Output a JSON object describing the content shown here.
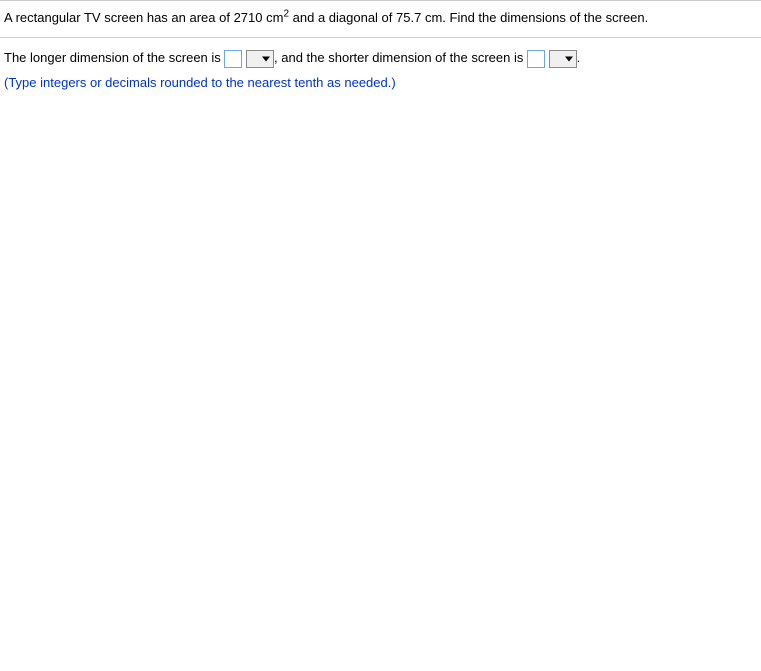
{
  "problem": {
    "text_before_area": "A rectangular TV screen has an area of ",
    "area_value": "2710",
    "area_unit_base": "cm",
    "area_unit_exp": "2",
    "text_between": " and a diagonal of ",
    "diagonal_value": "75.7",
    "diagonal_unit": "cm",
    "text_after": ". Find the dimensions of the screen."
  },
  "answer": {
    "prefix_longer": "The longer dimension of the screen is ",
    "between": ", and the shorter dimension of the screen is ",
    "suffix": ".",
    "input_longer_value": "",
    "input_shorter_value": "",
    "hint": "(Type integers or decimals rounded to the nearest tenth as needed.)"
  }
}
